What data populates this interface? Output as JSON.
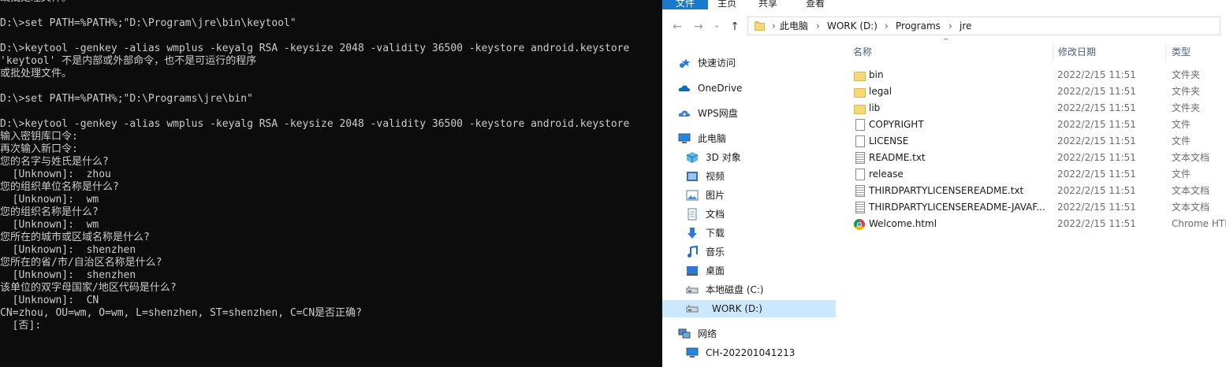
{
  "console": {
    "lines": [
      "或批处理文件。",
      "",
      "D:\\>set PATH=%PATH%;\"D:\\Program\\jre\\bin\\keytool\"",
      "",
      "D:\\>keytool -genkey -alias wmplus -keyalg RSA -keysize 2048 -validity 36500 -keystore android.keystore",
      "'keytool' 不是内部或外部命令，也不是可运行的程序",
      "或批处理文件。",
      "",
      "D:\\>set PATH=%PATH%;\"D:\\Programs\\jre\\bin\"",
      "",
      "D:\\>keytool -genkey -alias wmplus -keyalg RSA -keysize 2048 -validity 36500 -keystore android.keystore",
      "输入密钥库口令:",
      "再次输入新口令:",
      "您的名字与姓氏是什么?",
      "  [Unknown]:  zhou",
      "您的组织单位名称是什么?",
      "  [Unknown]:  wm",
      "您的组织名称是什么?",
      "  [Unknown]:  wm",
      "您所在的城市或区域名称是什么?",
      "  [Unknown]:  shenzhen",
      "您所在的省/市/自治区名称是什么?",
      "  [Unknown]:  shenzhen",
      "该单位的双字母国家/地区代码是什么?",
      "  [Unknown]:  CN",
      "CN=zhou, OU=wm, O=wm, L=shenzhen, ST=shenzhen, C=CN是否正确?",
      "  [否]:"
    ]
  },
  "explorer": {
    "ribbon": {
      "file": "文件",
      "home": "主页",
      "share": "共享",
      "view": "查看"
    },
    "nav": {
      "back": "←",
      "forward": "→",
      "recent": "⌄",
      "up": "↑"
    },
    "breadcrumb": [
      "此电脑",
      "WORK (D:)",
      "Programs",
      "jre"
    ],
    "columns": {
      "name": "名称",
      "date": "修改日期",
      "type": "类型"
    },
    "sidebar": [
      {
        "label": "快速访问",
        "icon": "star-icon"
      },
      {
        "label": "OneDrive",
        "icon": "cloud-icon"
      },
      {
        "label": "WPS网盘",
        "icon": "wps-cloud-icon"
      },
      {
        "label": "此电脑",
        "icon": "computer-icon"
      },
      {
        "label": "3D 对象",
        "icon": "cube-icon"
      },
      {
        "label": "视频",
        "icon": "video-icon"
      },
      {
        "label": "图片",
        "icon": "picture-icon"
      },
      {
        "label": "文档",
        "icon": "document-icon"
      },
      {
        "label": "下载",
        "icon": "download-icon"
      },
      {
        "label": "音乐",
        "icon": "music-icon"
      },
      {
        "label": "桌面",
        "icon": "desktop-icon"
      },
      {
        "label": "本地磁盘 (C:)",
        "icon": "drive-icon"
      },
      {
        "label": "WORK (D:)",
        "icon": "drive-icon",
        "selected": true
      },
      {
        "label": "网络",
        "icon": "network-icon"
      },
      {
        "label": "CH-202201041213",
        "icon": "computer-icon"
      }
    ],
    "files": [
      {
        "name": "bin",
        "date": "2022/2/15 11:51",
        "type": "文件夹",
        "icon": "folder-icon"
      },
      {
        "name": "legal",
        "date": "2022/2/15 11:51",
        "type": "文件夹",
        "icon": "folder-icon"
      },
      {
        "name": "lib",
        "date": "2022/2/15 11:51",
        "type": "文件夹",
        "icon": "folder-icon"
      },
      {
        "name": "COPYRIGHT",
        "date": "2022/2/15 11:51",
        "type": "文件",
        "icon": "file-icon"
      },
      {
        "name": "LICENSE",
        "date": "2022/2/15 11:51",
        "type": "文件",
        "icon": "file-icon"
      },
      {
        "name": "README.txt",
        "date": "2022/2/15 11:51",
        "type": "文本文档",
        "icon": "text-file-icon"
      },
      {
        "name": "release",
        "date": "2022/2/15 11:51",
        "type": "文件",
        "icon": "file-icon"
      },
      {
        "name": "THIRDPARTYLICENSEREADME.txt",
        "date": "2022/2/15 11:51",
        "type": "文本文档",
        "icon": "text-file-icon"
      },
      {
        "name": "THIRDPARTYLICENSEREADME-JAVAF...",
        "date": "2022/2/15 11:51",
        "type": "文本文档",
        "icon": "text-file-icon"
      },
      {
        "name": "Welcome.html",
        "date": "2022/2/15 11:51",
        "type": "Chrome HTI",
        "icon": "chrome-icon"
      }
    ]
  }
}
